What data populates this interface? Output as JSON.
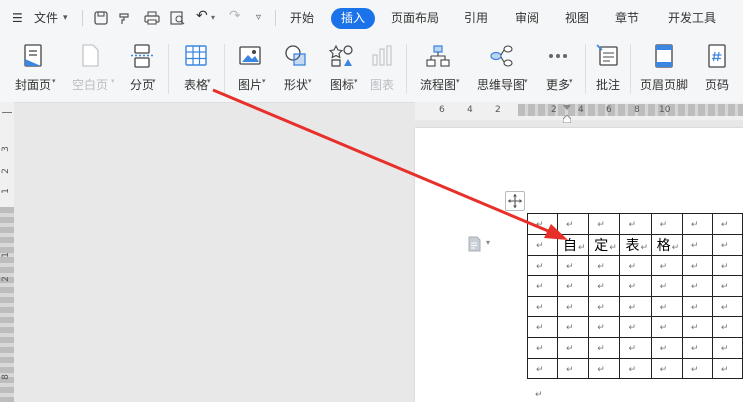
{
  "menu": {
    "file_label": "文件",
    "tabs": [
      "开始",
      "插入",
      "页面布局",
      "引用",
      "审阅",
      "视图",
      "章节",
      "开发工具"
    ],
    "active_tab": "插入"
  },
  "ribbon": {
    "cover_page": "封面页",
    "blank_page": "空白页",
    "page_break": "分页",
    "table": "表格",
    "picture": "图片",
    "shape": "形状",
    "icon": "图标",
    "chart": "图表",
    "flowchart": "流程图",
    "mindmap": "思维导图",
    "more": "更多",
    "comment": "批注",
    "header_footer": "页眉页脚",
    "page_number": "页码"
  },
  "ruler": {
    "top_numbers": [
      "6",
      "4",
      "2",
      "2",
      "4",
      "6",
      "8",
      "10"
    ],
    "left_numbers": [
      "3",
      "2",
      "1",
      "1",
      "2",
      "8"
    ]
  },
  "table": {
    "rows": 8,
    "cols": 7,
    "return_mark": "↵",
    "text_cells": [
      "自",
      "定",
      "表",
      "格"
    ]
  },
  "colors": {
    "active_tab": "#1a73e8",
    "arrow": "#e8302a"
  }
}
